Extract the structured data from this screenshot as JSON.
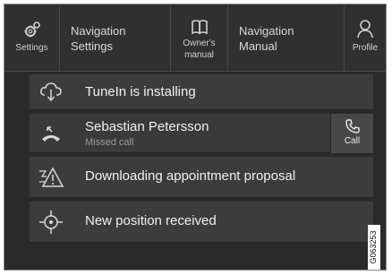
{
  "topbar": {
    "settings": {
      "label": "Settings",
      "icon": "gear-icon"
    },
    "navigation_settings": {
      "label_line1": "Navigation",
      "label_line2": "Settings"
    },
    "owners_manual": {
      "label_line1": "Owner's",
      "label_line2": "manual",
      "icon": "book-icon"
    },
    "navigation_manual": {
      "label_line1": "Navigation",
      "label_line2": "Manual"
    },
    "profile": {
      "label": "Profile",
      "icon": "person-icon"
    }
  },
  "notifications": [
    {
      "title": "TuneIn is installing",
      "icon": "cloud-download-icon"
    },
    {
      "title": "Sebastian Petersson",
      "subtitle": "Missed call",
      "icon": "missed-call-icon",
      "action_label": "Call",
      "action_icon": "phone-icon"
    },
    {
      "title": "Downloading appointment proposal",
      "icon": "warning-triangle-icon"
    },
    {
      "title": "New position received",
      "icon": "position-target-icon"
    }
  ],
  "image_code": "G063253",
  "colors": {
    "background": "#2a2a2a",
    "row": "#3c3c3c",
    "text": "#f0f0f0",
    "subtext": "#9a9a9a"
  }
}
